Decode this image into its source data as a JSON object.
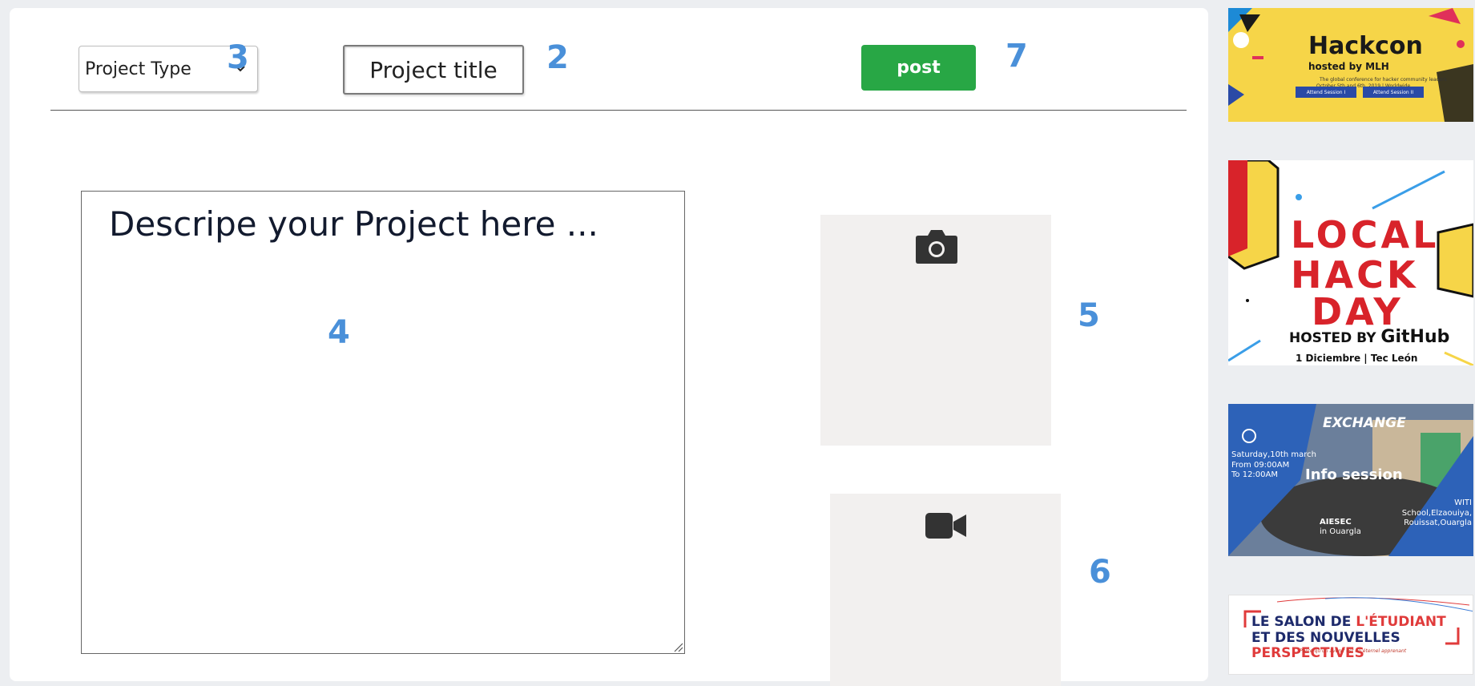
{
  "toolbar": {
    "project_type_selected": "Project Type",
    "project_title_placeholder": "Project title",
    "post_label": "post"
  },
  "annotations": {
    "n3": "3",
    "n2": "2",
    "n7": "7",
    "n4": "4",
    "n5": "5",
    "n6": "6"
  },
  "description": {
    "placeholder": "Descripe your Project here ..."
  },
  "icons": {
    "select_arrow": "chevron-down-icon",
    "photo": "camera-icon",
    "video": "video-camera-icon"
  },
  "colors": {
    "post_button": "#28a745",
    "annotation_blue": "#4a90d9",
    "upload_box_bg": "#f2f0ef"
  },
  "ads": {
    "hackcon": {
      "title": "Hackcon",
      "subtitle": "hosted by MLH",
      "desc": "The global conference for hacker community leaders",
      "desc2": "October 5th and 6th, 2019 | Worldwide",
      "btn1": "Attend Session I",
      "btn2": "Attend Session II"
    },
    "local_hack_day": {
      "line1": "LOCAL",
      "line2": "HACK",
      "line3": "DAY",
      "hosted": "HOSTED BY",
      "brand": "GitHub",
      "place": "1 Diciembre | Tec León"
    },
    "exchange": {
      "logo": "EXCHANGE",
      "date1": "Saturday,10th march",
      "date2": "From 09:00AM",
      "date3": "To 12:00AM",
      "info": "Info session",
      "org": "AIESEC",
      "org_place": "in Ouargla",
      "loc1": "WITI School,Elzaouiya,",
      "loc2": "Rouissat,Ouargla"
    },
    "salon": {
      "line1a": "LE SALON DE ",
      "line1b": "L'ÉTUDIANT",
      "line2a": "ET DES NOUVELLES ",
      "line2b": "PERSPECTIVES",
      "tagline": "Parce qu'un avenir est un éternel apprenant"
    }
  }
}
